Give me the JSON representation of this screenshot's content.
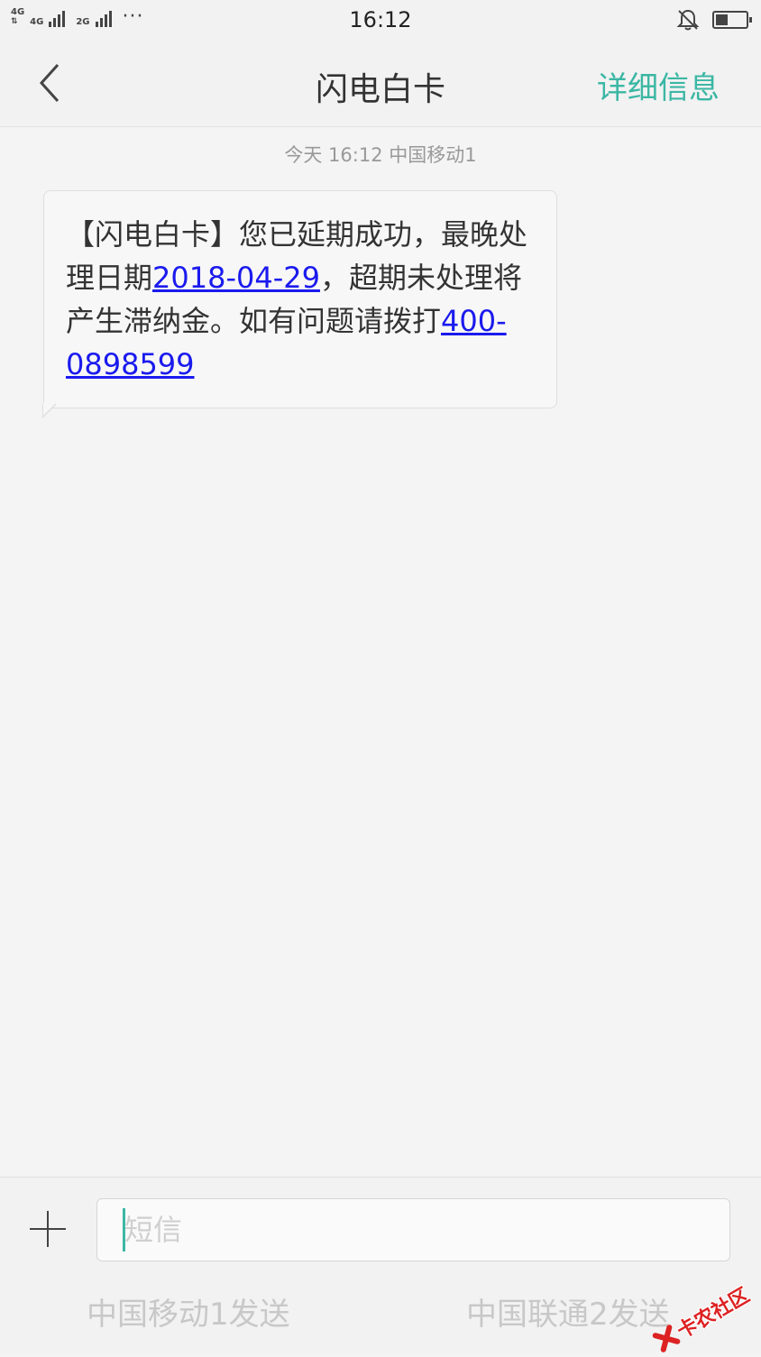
{
  "status_bar": {
    "net1": "4G",
    "net2": "4G",
    "net3": "2G",
    "dots": "···",
    "time": "16:12",
    "icons": [
      "bell-muted-icon",
      "battery-icon"
    ]
  },
  "header": {
    "back_icon": "chevron-left-icon",
    "title": "闪电白卡",
    "details_label": "详细信息",
    "accent_color": "#3bb7a4"
  },
  "conversation": {
    "timestamp": "今天 16:12 中国移动1",
    "message": {
      "part1": "【闪电白卡】您已延期成功，最晚处理日期",
      "date_link": "2018-04-29",
      "part2": "，超期未处理将产生滞纳金。如有问题请拨打",
      "phone_link": "400-0898599"
    },
    "link_color": "#1a1aee"
  },
  "compose": {
    "plus_icon": "plus-icon",
    "placeholder": "短信",
    "send_sim1": "中国移动1发送",
    "send_sim2": "中国联通2发送"
  },
  "watermark": {
    "text": "卡农社区"
  }
}
